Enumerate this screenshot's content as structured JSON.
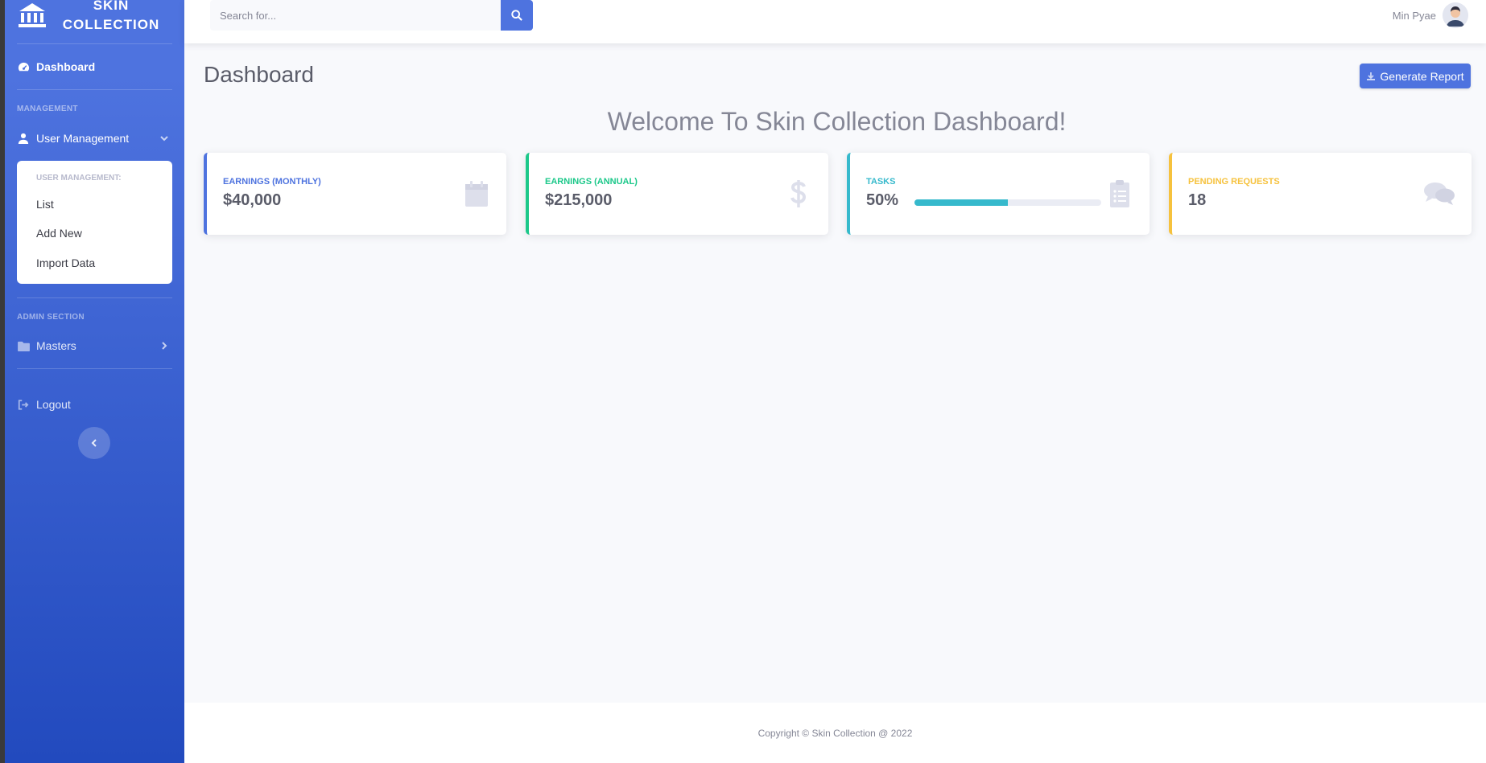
{
  "sidebar": {
    "brand_line1": "SKIN",
    "brand_line2": "COLLECTION",
    "dashboard_label": "Dashboard",
    "heading_management": "MANAGEMENT",
    "user_management_label": "User Management",
    "submenu": {
      "header": "USER MANAGEMENT:",
      "items": [
        "List",
        "Add New",
        "Import Data"
      ]
    },
    "heading_admin": "ADMIN SECTION",
    "masters_label": "Masters",
    "logout_label": "Logout"
  },
  "topbar": {
    "search_placeholder": "Search for...",
    "user_name": "Min Pyae"
  },
  "main": {
    "title": "Dashboard",
    "generate_report_label": "Generate Report",
    "welcome": "Welcome To Skin Collection Dashboard!"
  },
  "cards": [
    {
      "label": "EARNINGS (MONTHLY)",
      "value": "$40,000",
      "color": "#4e73df",
      "icon": "calendar-icon"
    },
    {
      "label": "EARNINGS (ANNUAL)",
      "value": "$215,000",
      "color": "#1cc88a",
      "icon": "dollar-icon"
    },
    {
      "label": "TASKS",
      "value": "50%",
      "color": "#36b9cc",
      "icon": "clipboard-list-icon",
      "progress": 0.5
    },
    {
      "label": "PENDING REQUESTS",
      "value": "18",
      "color": "#f6c23e",
      "icon": "comments-icon"
    }
  ],
  "footer": {
    "text": "Copyright © Skin Collection @ 2022"
  },
  "colors": {
    "primary": "#4e73df",
    "success": "#1cc88a",
    "info": "#36b9cc",
    "warning": "#f6c23e"
  }
}
